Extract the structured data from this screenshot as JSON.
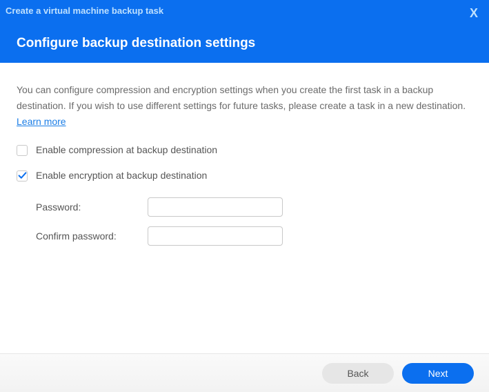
{
  "header": {
    "wizard_title": "Create a virtual machine backup task",
    "subtitle": "Configure backup destination settings",
    "close_label": "X"
  },
  "content": {
    "description_pre": "You can configure compression and encryption settings when you create the first task in a backup destination. If you wish to use different settings for future tasks, please create a task in a new destination. ",
    "learn_more": "Learn more"
  },
  "options": {
    "compression": {
      "label": "Enable compression at backup destination",
      "checked": false
    },
    "encryption": {
      "label": "Enable encryption at backup destination",
      "checked": true
    }
  },
  "fields": {
    "password": {
      "label": "Password:",
      "value": ""
    },
    "confirm_password": {
      "label": "Confirm password:",
      "value": ""
    }
  },
  "footer": {
    "back": "Back",
    "next": "Next"
  }
}
